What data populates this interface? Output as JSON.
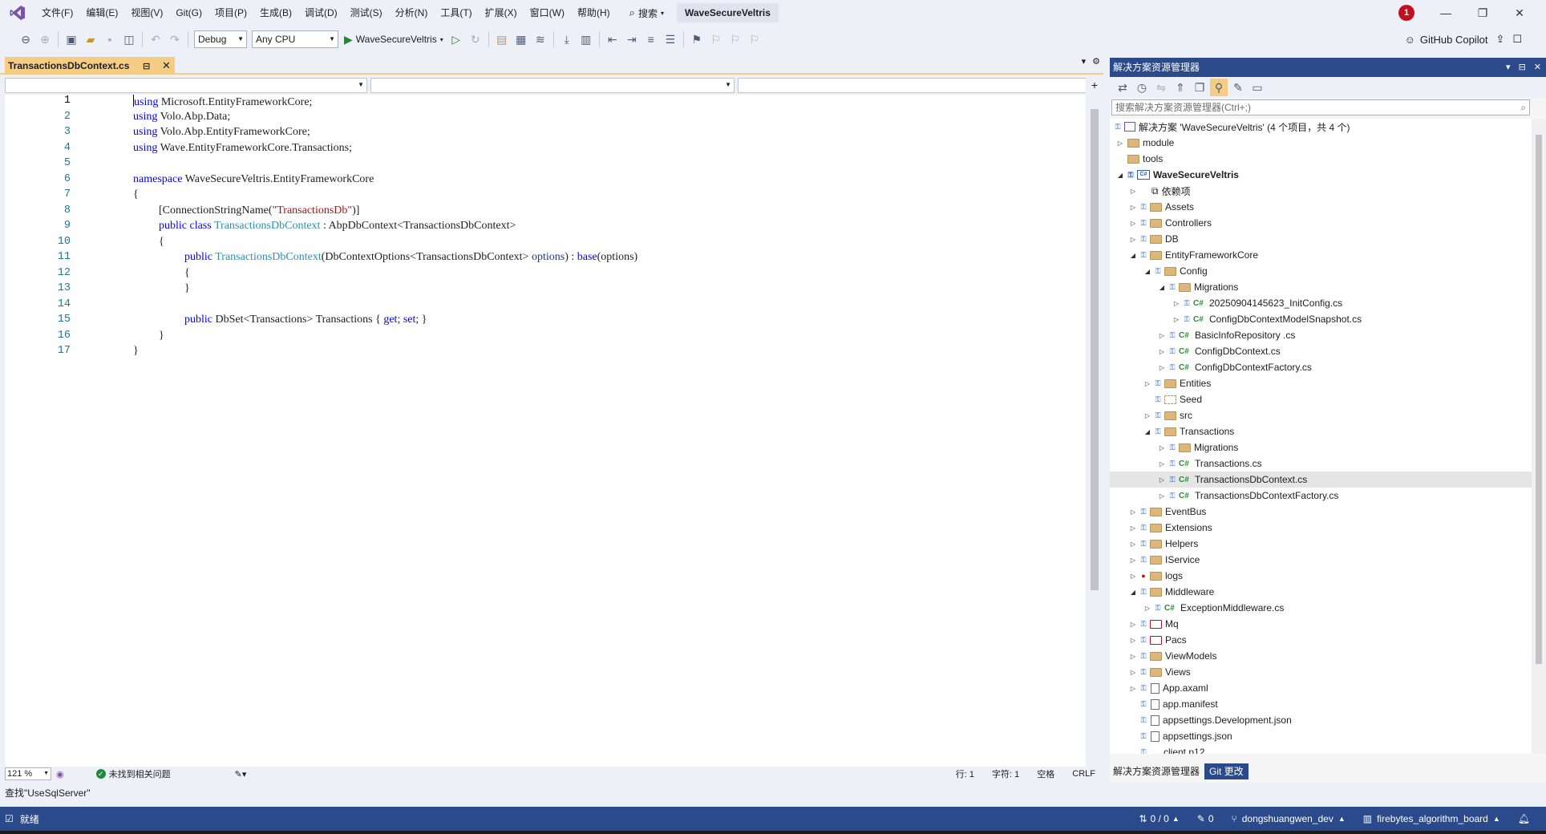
{
  "menu": [
    "文件(F)",
    "编辑(E)",
    "视图(V)",
    "Git(G)",
    "项目(P)",
    "生成(B)",
    "调试(D)",
    "测试(S)",
    "分析(N)",
    "工具(T)",
    "扩展(X)",
    "窗口(W)",
    "帮助(H)"
  ],
  "search_label": "搜索",
  "solution_name": "WaveSecureVeltris",
  "notification_count": "1",
  "toolbar": {
    "config": "Debug",
    "platform": "Any CPU",
    "run_target": "WaveSecureVeltris",
    "copilot": "GitHub Copilot"
  },
  "editor": {
    "tab_title": "TransactionsDbContext.cs",
    "zoom": "121 %",
    "issues": "未找到相关问题",
    "line": "行: 1",
    "col": "字符: 1",
    "spaces": "空格",
    "eol": "CRLF"
  },
  "code": {
    "line_numbers": [
      "1",
      "2",
      "3",
      "4",
      "5",
      "6",
      "7",
      "8",
      "9",
      "10",
      "11",
      "12",
      "13",
      "14",
      "15",
      "16",
      "17"
    ],
    "l1_kw": "using",
    "l1_rest": " Microsoft.EntityFrameworkCore;",
    "l2_kw": "using",
    "l2_rest": " Volo.Abp.Data;",
    "l3_kw": "using",
    "l3_rest": " Volo.Abp.EntityFrameworkCore;",
    "l4_kw": "using",
    "l4_rest": " Wave.EntityFrameworkCore.Transactions;",
    "l6_kw": "namespace",
    "l6_rest": " WaveSecureVeltris.EntityFrameworkCore",
    "l7": "{",
    "l8_a": "[ConnectionStringName(",
    "l8_str": "\"TransactionsDb\"",
    "l8_b": ")]",
    "l9_kw": "public class",
    "l9_ty": "TransactionsDbContext",
    "l9_rest": " : AbpDbContext<TransactionsDbContext>",
    "l10": "{",
    "l11_kw": "public",
    "l11_ty": "TransactionsDbContext",
    "l11_a": "(DbContextOptions<TransactionsDbContext> ",
    "l11_opt": "options",
    "l11_b": ") : ",
    "l11_base": "base",
    "l11_c": "(options)",
    "l12": "{",
    "l13": "}",
    "l15_kw": "public",
    "l15_a": " DbSet<Transactions> Transactions { ",
    "l15_get": "get",
    "l15_b": "; ",
    "l15_set": "set",
    "l15_c": "; }",
    "l16": "}",
    "l17": "}"
  },
  "find_bar": "查找\"UseSqlServer\"",
  "statusbar": {
    "ready": "就绪",
    "sync": "0 / 0",
    "changes": "0",
    "branch": "dongshuangwen_dev",
    "repo": "firebytes_algorithm_board"
  },
  "solution_explorer": {
    "title": "解决方案资源管理器",
    "search_placeholder": "搜索解决方案资源管理器(Ctrl+;)",
    "tab_explorer": "解决方案资源管理器",
    "tab_git": "Git 更改",
    "items": [
      "解决方案 'WaveSecureVeltris' (4 个项目，共 4 个)",
      "module",
      "tools",
      "WaveSecureVeltris",
      "依赖项",
      "Assets",
      "Controllers",
      "DB",
      "EntityFrameworkCore",
      "Config",
      "Migrations",
      "20250904145623_InitConfig.cs",
      "ConfigDbContextModelSnapshot.cs",
      "BasicInfoRepository .cs",
      "ConfigDbContext.cs",
      "ConfigDbContextFactory.cs",
      "Entities",
      "Seed",
      "src",
      "Transactions",
      "Migrations",
      "Transactions.cs",
      "TransactionsDbContext.cs",
      "TransactionsDbContextFactory.cs",
      "EventBus",
      "Extensions",
      "Helpers",
      "IService",
      "logs",
      "Middleware",
      "ExceptionMiddleware.cs",
      "Mq",
      "Pacs",
      "ViewModels",
      "Views",
      "App.axaml",
      "app.manifest",
      "appsettings.Development.json",
      "appsettings.json",
      "client.p12"
    ]
  }
}
